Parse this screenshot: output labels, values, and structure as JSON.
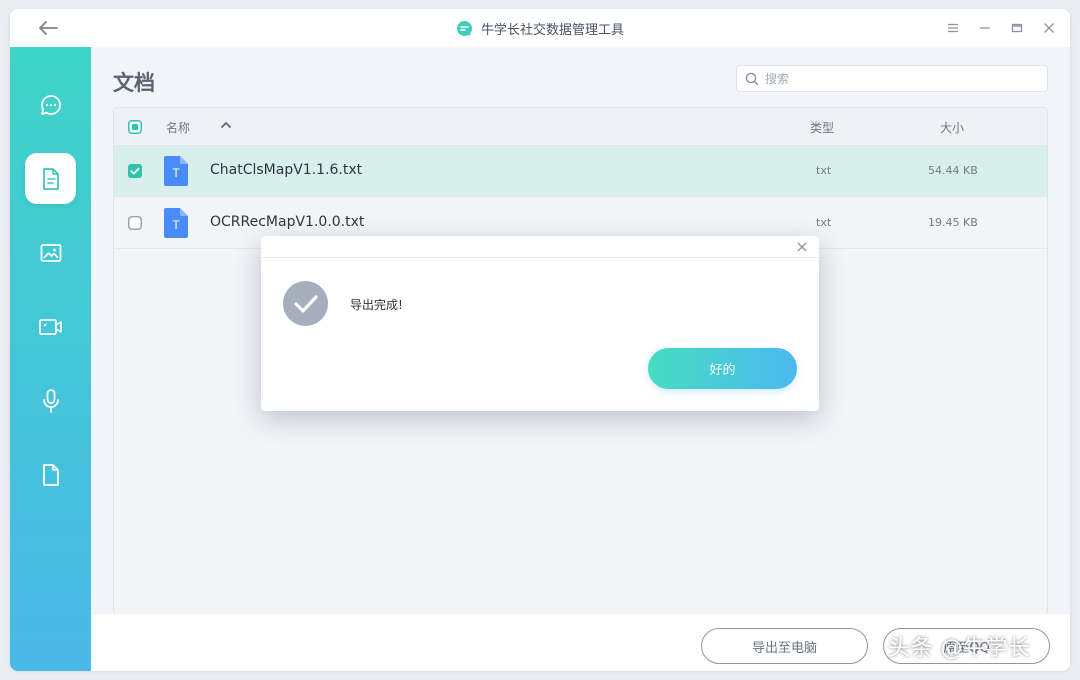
{
  "window": {
    "title": "牛学长社交数据管理工具"
  },
  "page": {
    "title": "文档"
  },
  "search": {
    "placeholder": "搜索"
  },
  "table": {
    "headers": {
      "name": "名称",
      "type": "类型",
      "size": "大小"
    },
    "rows": [
      {
        "name": "ChatClsMapV1.1.6.txt",
        "type": "txt",
        "size": "54.44 KB",
        "checked": true,
        "file_icon_letter": "T"
      },
      {
        "name": "OCRRecMapV1.0.0.txt",
        "type": "txt",
        "size": "19.45 KB",
        "checked": false,
        "file_icon_letter": "T"
      }
    ]
  },
  "footer": {
    "export_pc_label": "导出至电脑",
    "second_button_partial": "原至QQ"
  },
  "dialog": {
    "message": "导出完成!",
    "ok_label": "好的"
  },
  "watermark": {
    "text": "头条 @牛学长"
  },
  "colors": {
    "accent_start": "#3ed4c7",
    "accent_end": "#4ab8e8",
    "selected_row": "#d8f0eb",
    "file_icon": "#4a8cf7",
    "check_green": "#2fc3b0"
  },
  "icons": {
    "sidebar": [
      "chat-icon",
      "document-icon",
      "image-icon",
      "video-icon",
      "microphone-icon",
      "file-icon"
    ]
  }
}
